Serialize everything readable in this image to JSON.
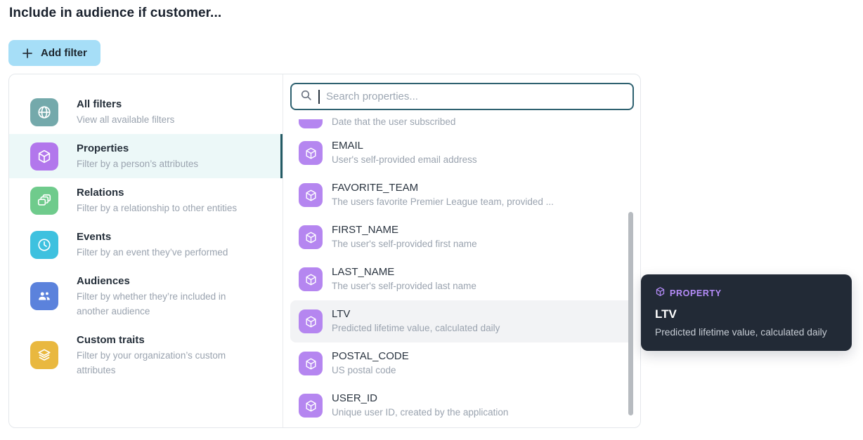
{
  "page": {
    "heading": "Include in audience if customer..."
  },
  "toolbar": {
    "add_filter_label": "Add filter"
  },
  "sidebar": {
    "selected_item": "Properties",
    "items": [
      {
        "label": "All filters",
        "description": "View all available filters",
        "icon": "globe-icon",
        "color": "#74a9ab",
        "selected": false
      },
      {
        "label": "Properties",
        "description": "Filter by a person’s attributes",
        "icon": "cube-icon",
        "color": "#b277ec",
        "selected": true
      },
      {
        "label": "Relations",
        "description": "Filter by a relationship to other entities",
        "icon": "cards-icon",
        "color": "#6fcb8c",
        "selected": false
      },
      {
        "label": "Events",
        "description": "Filter by an event they’ve performed",
        "icon": "clock-icon",
        "color": "#3ec1df",
        "selected": false
      },
      {
        "label": "Audiences",
        "description": "Filter by whether they’re included in another audience",
        "icon": "people-icon",
        "color": "#5b82dc",
        "selected": false
      },
      {
        "label": "Custom traits",
        "description": "Filter by your organization’s custom attributes",
        "icon": "layers-icon",
        "color": "#e9b83f",
        "selected": false
      }
    ]
  },
  "search": {
    "placeholder": "Search properties...",
    "value": ""
  },
  "properties_list": {
    "highlighted_item": "LTV",
    "partial_item": {
      "description": "Date that the user subscribed"
    },
    "items": [
      {
        "name": "EMAIL",
        "description": "User's self-provided email address"
      },
      {
        "name": "FAVORITE_TEAM",
        "description": "The users favorite Premier League team, provided ..."
      },
      {
        "name": "FIRST_NAME",
        "description": "The user's self-provided first name"
      },
      {
        "name": "LAST_NAME",
        "description": "The user's self-provided last name"
      },
      {
        "name": "LTV",
        "description": "Predicted lifetime value, calculated daily"
      },
      {
        "name": "POSTAL_CODE",
        "description": "US postal code"
      },
      {
        "name": "USER_ID",
        "description": "Unique user ID, created by the application"
      }
    ]
  },
  "tooltip": {
    "badge": "PROPERTY",
    "title": "LTV",
    "description": "Predicted lifetime value, calculated daily"
  },
  "colors": {
    "add_filter_bg": "#a6def7",
    "selected_sidebar_bg": "#ecf8f8",
    "selected_sidebar_bar": "#235a64",
    "search_border": "#2e6170",
    "property_icon": "#b586f0",
    "highlight_row_bg": "#f2f3f5",
    "tooltip_bg": "#222a36",
    "tooltip_accent": "#b48cf8",
    "title_text": "#252f3a",
    "subtitle_text": "#9aa3af"
  }
}
